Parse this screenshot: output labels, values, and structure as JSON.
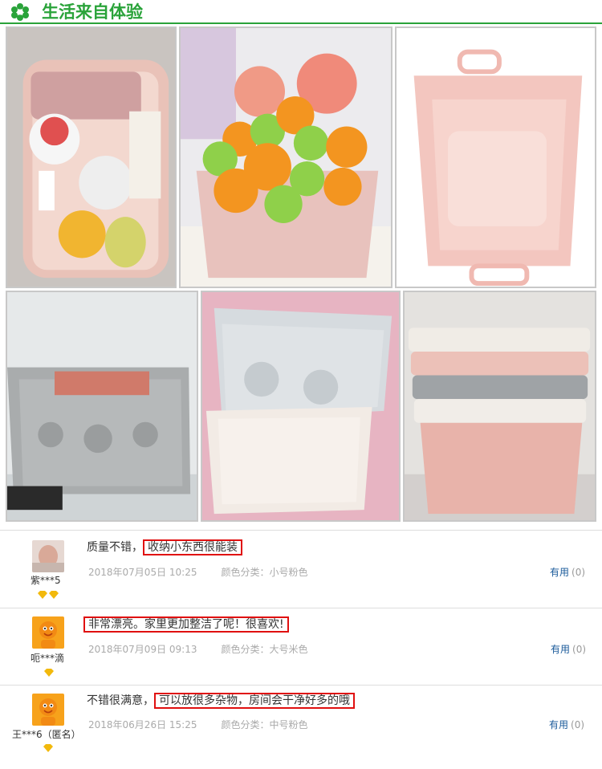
{
  "header": {
    "title": "生活来自体验"
  },
  "reviews": [
    {
      "user": "紫***5",
      "text_prefix": "质量不错，",
      "text_highlight": "收纳小东西很能装",
      "date": "2018年07月05日 10:25",
      "spec": "颜色分类：小号粉色",
      "useful_label": "有用",
      "useful_count": "(0)"
    },
    {
      "user": "呃***滴",
      "text_prefix": "",
      "text_highlight": "非常漂亮。家里更加整洁了呢！很喜欢!",
      "date": "2018年07月09日 09:13",
      "spec": "颜色分类：大号米色",
      "useful_label": "有用",
      "useful_count": "(0)"
    },
    {
      "user": "王***6（匿名）",
      "text_prefix": "不错很满意，",
      "text_highlight": "可以放很多杂物，房间会干净好多的哦",
      "date": "2018年06月26日 15:25",
      "spec": "颜色分类：中号粉色",
      "useful_label": "有用",
      "useful_count": "(0)"
    }
  ],
  "colors": {
    "brand_green": "#2aa33a",
    "highlight_red": "#e01010",
    "link_blue": "#1a5a9a"
  }
}
